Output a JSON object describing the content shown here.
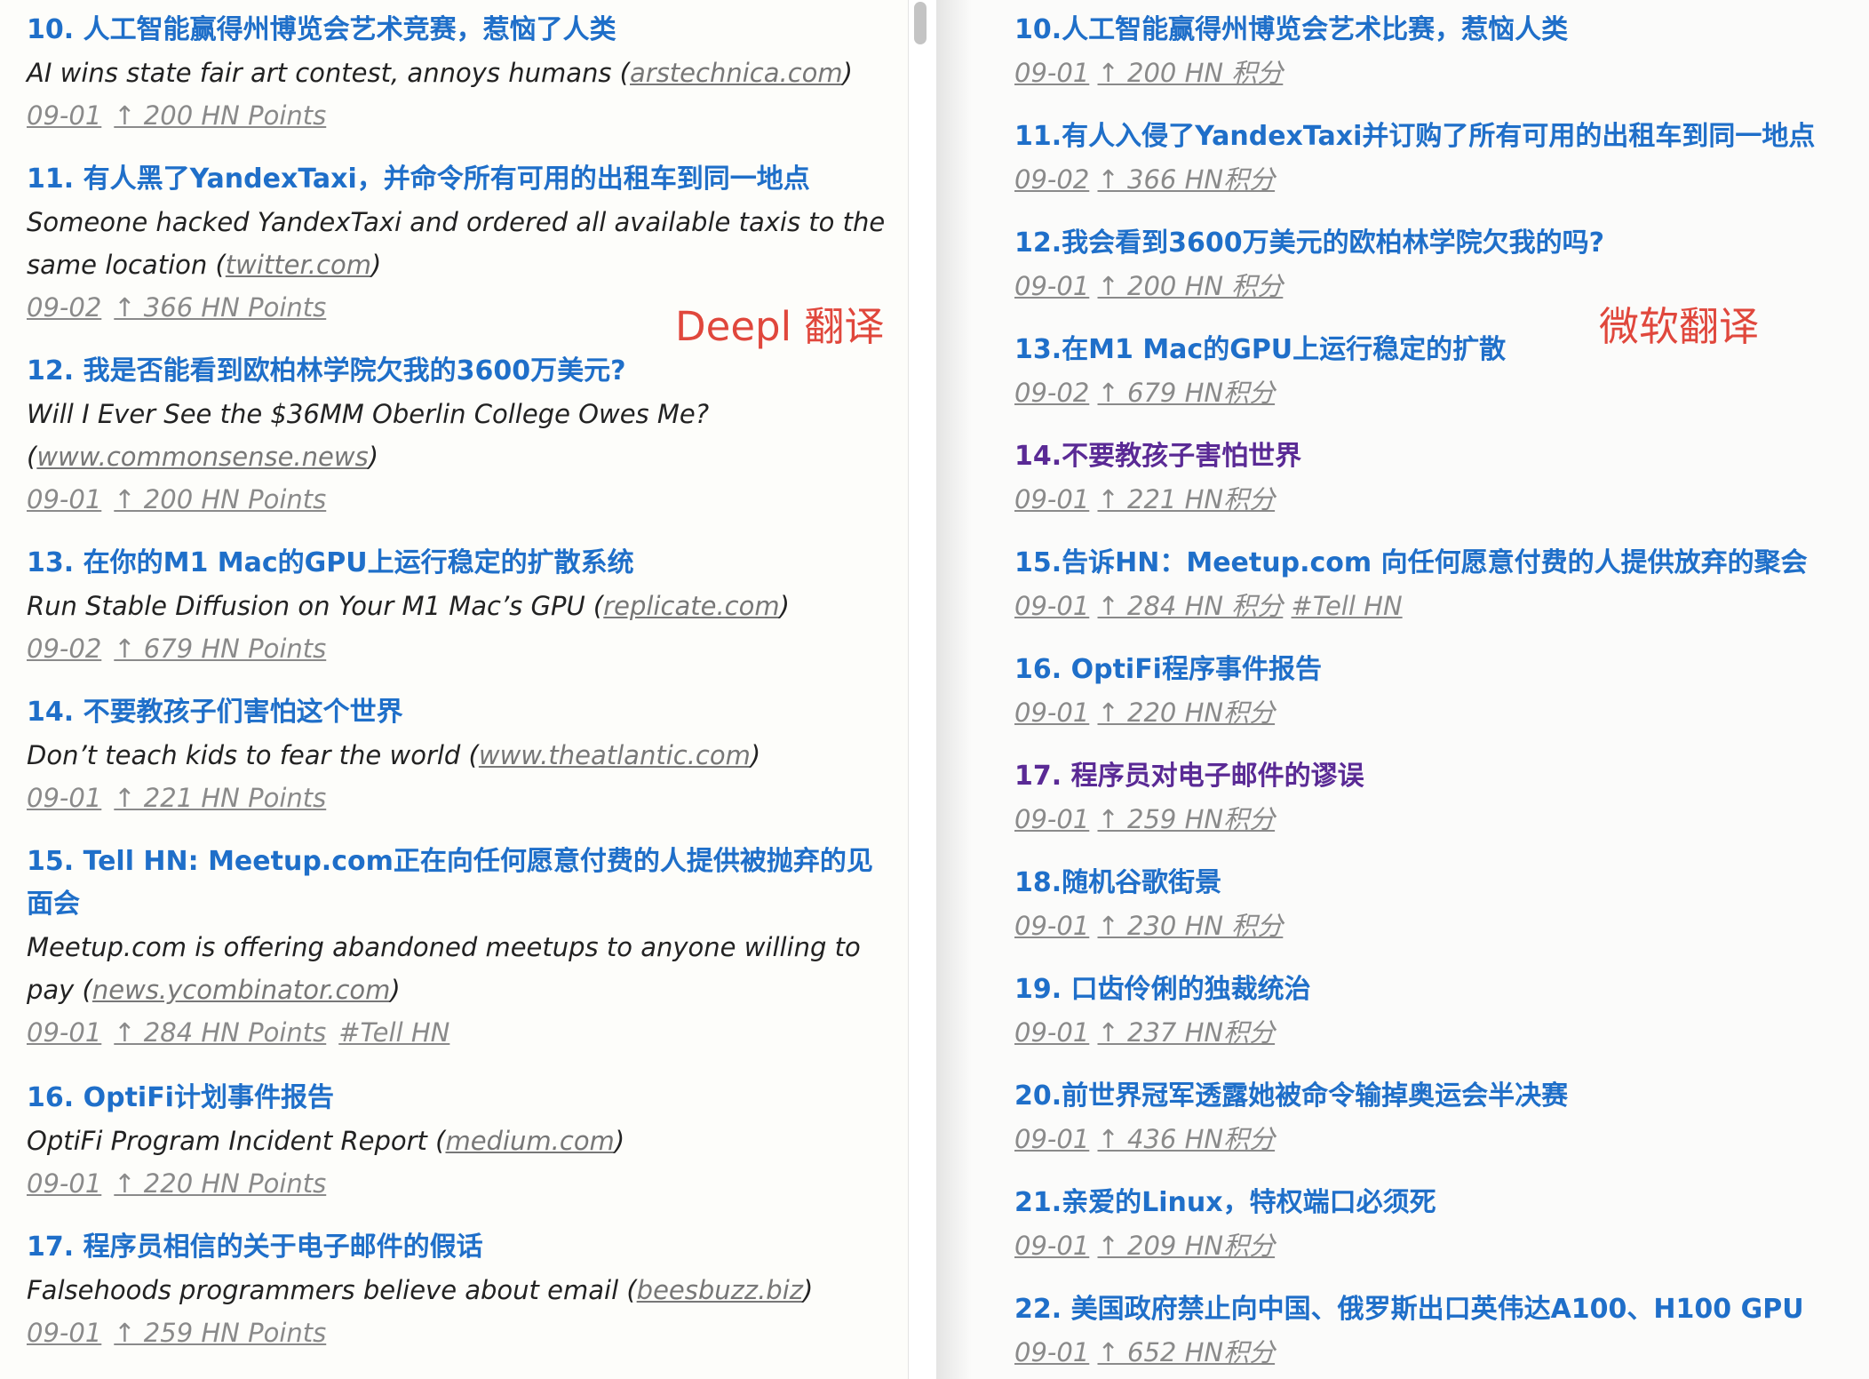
{
  "labels": {
    "deepl": "Deepl 翻译",
    "microsoft": "微软翻译"
  },
  "left": {
    "items": [
      {
        "title": "10. 人工智能赢得州博览会艺术竞赛，惹恼了人类",
        "orig": "AI wins state fair art contest, annoys humans (",
        "domain": "arstechnica.com",
        "close": ")",
        "date": "09-01",
        "points": "↑ 200 HN Points"
      },
      {
        "title": "11. 有人黑了YandexTaxi，并命令所有可用的出租车到同一地点",
        "orig": "Someone hacked YandexTaxi and ordered all available taxis to the same location (",
        "domain": "twitter.com",
        "close": ")",
        "date": "09-02",
        "points": "↑ 366 HN Points"
      },
      {
        "title": "12. 我是否能看到欧柏林学院欠我的3600万美元?",
        "orig": "Will I Ever See the $36MM Oberlin College Owes Me? (",
        "domain": "www.commonsense.news",
        "close": ")",
        "date": "09-01",
        "points": "↑ 200 HN Points"
      },
      {
        "title": "13. 在你的M1 Mac的GPU上运行稳定的扩散系统",
        "orig": "Run Stable Diffusion on Your M1 Mac’s GPU (",
        "domain": "replicate.com",
        "close": ")",
        "date": "09-02",
        "points": "↑ 679 HN Points"
      },
      {
        "title": "14. 不要教孩子们害怕这个世界",
        "orig": "Don’t teach kids to fear the world (",
        "domain": "www.theatlantic.com",
        "close": ")",
        "date": "09-01",
        "points": "↑ 221 HN Points"
      },
      {
        "title": "15. Tell HN: Meetup.com正在向任何愿意付费的人提供被抛弃的见面会",
        "orig": "Meetup.com is offering abandoned meetups to anyone willing to pay (",
        "domain": "news.ycombinator.com",
        "close": ")",
        "date": "09-01",
        "points": "↑ 284 HN Points",
        "tag": "#Tell HN"
      },
      {
        "title": "16. OptiFi计划事件报告",
        "orig": "OptiFi Program Incident Report (",
        "domain": "medium.com",
        "close": ")",
        "date": "09-01",
        "points": "↑ 220 HN Points"
      },
      {
        "title": "17. 程序员相信的关于电子邮件的假话",
        "orig": "Falsehoods programmers believe about email (",
        "domain": "beesbuzz.biz",
        "close": ")",
        "date": "09-01",
        "points": "↑ 259 HN Points"
      }
    ]
  },
  "right": {
    "items": [
      {
        "title": "10.人工智能赢得州博览会艺术比赛，惹恼人类",
        "date": "09-01",
        "points": "↑ 200 HN 积分"
      },
      {
        "title": "11.有人入侵了YandexTaxi并订购了所有可用的出租车到同一地点",
        "date": "09-02",
        "points": "↑ 366 HN积分"
      },
      {
        "title": "12.我会看到3600万美元的欧柏林学院欠我的吗?",
        "date": "09-01",
        "points": "↑ 200 HN 积分"
      },
      {
        "title": "13.在M1 Mac的GPU上运行稳定的扩散",
        "date": "09-02",
        "points": "↑ 679 HN积分"
      },
      {
        "title": "14.不要教孩子害怕世界",
        "date": "09-01",
        "points": "↑ 221 HN积分"
      },
      {
        "title": "15.告诉HN：Meetup.com 向任何愿意付费的人提供放弃的聚会",
        "date": "09-01",
        "points": "↑ 284 HN 积分",
        "tag": "#Tell HN"
      },
      {
        "title": "16. OptiFi程序事件报告",
        "date": "09-01",
        "points": "↑ 220 HN积分"
      },
      {
        "title": "17. 程序员对电子邮件的谬误",
        "date": "09-01",
        "points": "↑ 259 HN积分"
      },
      {
        "title": "18.随机谷歌街景",
        "date": "09-01",
        "points": "↑ 230 HN 积分"
      },
      {
        "title": "19. 口齿伶俐的独裁统治",
        "date": "09-01",
        "points": "↑ 237 HN积分"
      },
      {
        "title": "20.前世界冠军透露她被命令输掉奥运会半决赛",
        "date": "09-01",
        "points": "↑ 436 HN积分"
      },
      {
        "title": "21.亲爱的Linux，特权端口必须死",
        "date": "09-01",
        "points": "↑ 209 HN积分"
      },
      {
        "title": "22. 美国政府禁止向中国、俄罗斯出口英伟达A100、H100 GPU",
        "date": "09-01",
        "points": "↑ 652 HN积分"
      }
    ]
  }
}
